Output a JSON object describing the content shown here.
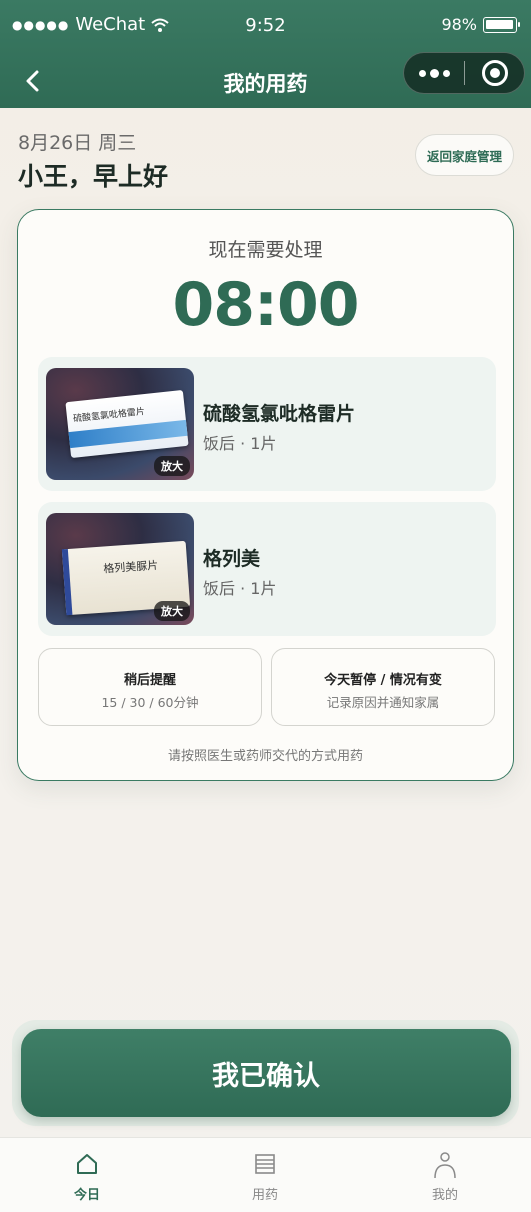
{
  "status_bar": {
    "carrier": "WeChat",
    "time": "9:52",
    "battery": "98%"
  },
  "nav": {
    "title": "我的用药"
  },
  "greeting": {
    "date": "8月26日 周三",
    "text": "小王，早上好",
    "family_button": "返回家庭管理"
  },
  "card": {
    "subtitle": "现在需要处理",
    "time": "08:00",
    "medications": [
      {
        "name": "硫酸氢氯吡格雷片",
        "dose": "饭后 · 1片",
        "zoom": "放大",
        "box_text": "硫酸氢氯吡格雷片"
      },
      {
        "name": "格列美",
        "dose": "饭后 · 1片",
        "zoom": "放大",
        "box_text": "格列美脲片"
      }
    ],
    "actions": [
      {
        "title": "稍后提醒",
        "subtitle": "15 / 30 / 60分钟"
      },
      {
        "title": "今天暂停 / 情况有变",
        "subtitle": "记录原因并通知家属"
      }
    ],
    "note": "请按照医生或药师交代的方式用药"
  },
  "confirm": {
    "label": "我已确认"
  },
  "tabs": [
    {
      "label": "今日",
      "icon": "home-icon",
      "active": true
    },
    {
      "label": "用药",
      "icon": "list-icon",
      "active": false
    },
    {
      "label": "我的",
      "icon": "user-icon",
      "active": false
    }
  ],
  "colors": {
    "primary": "#2f6b55",
    "card_border": "#3a7a62",
    "med_bg": "#eef4f1"
  }
}
